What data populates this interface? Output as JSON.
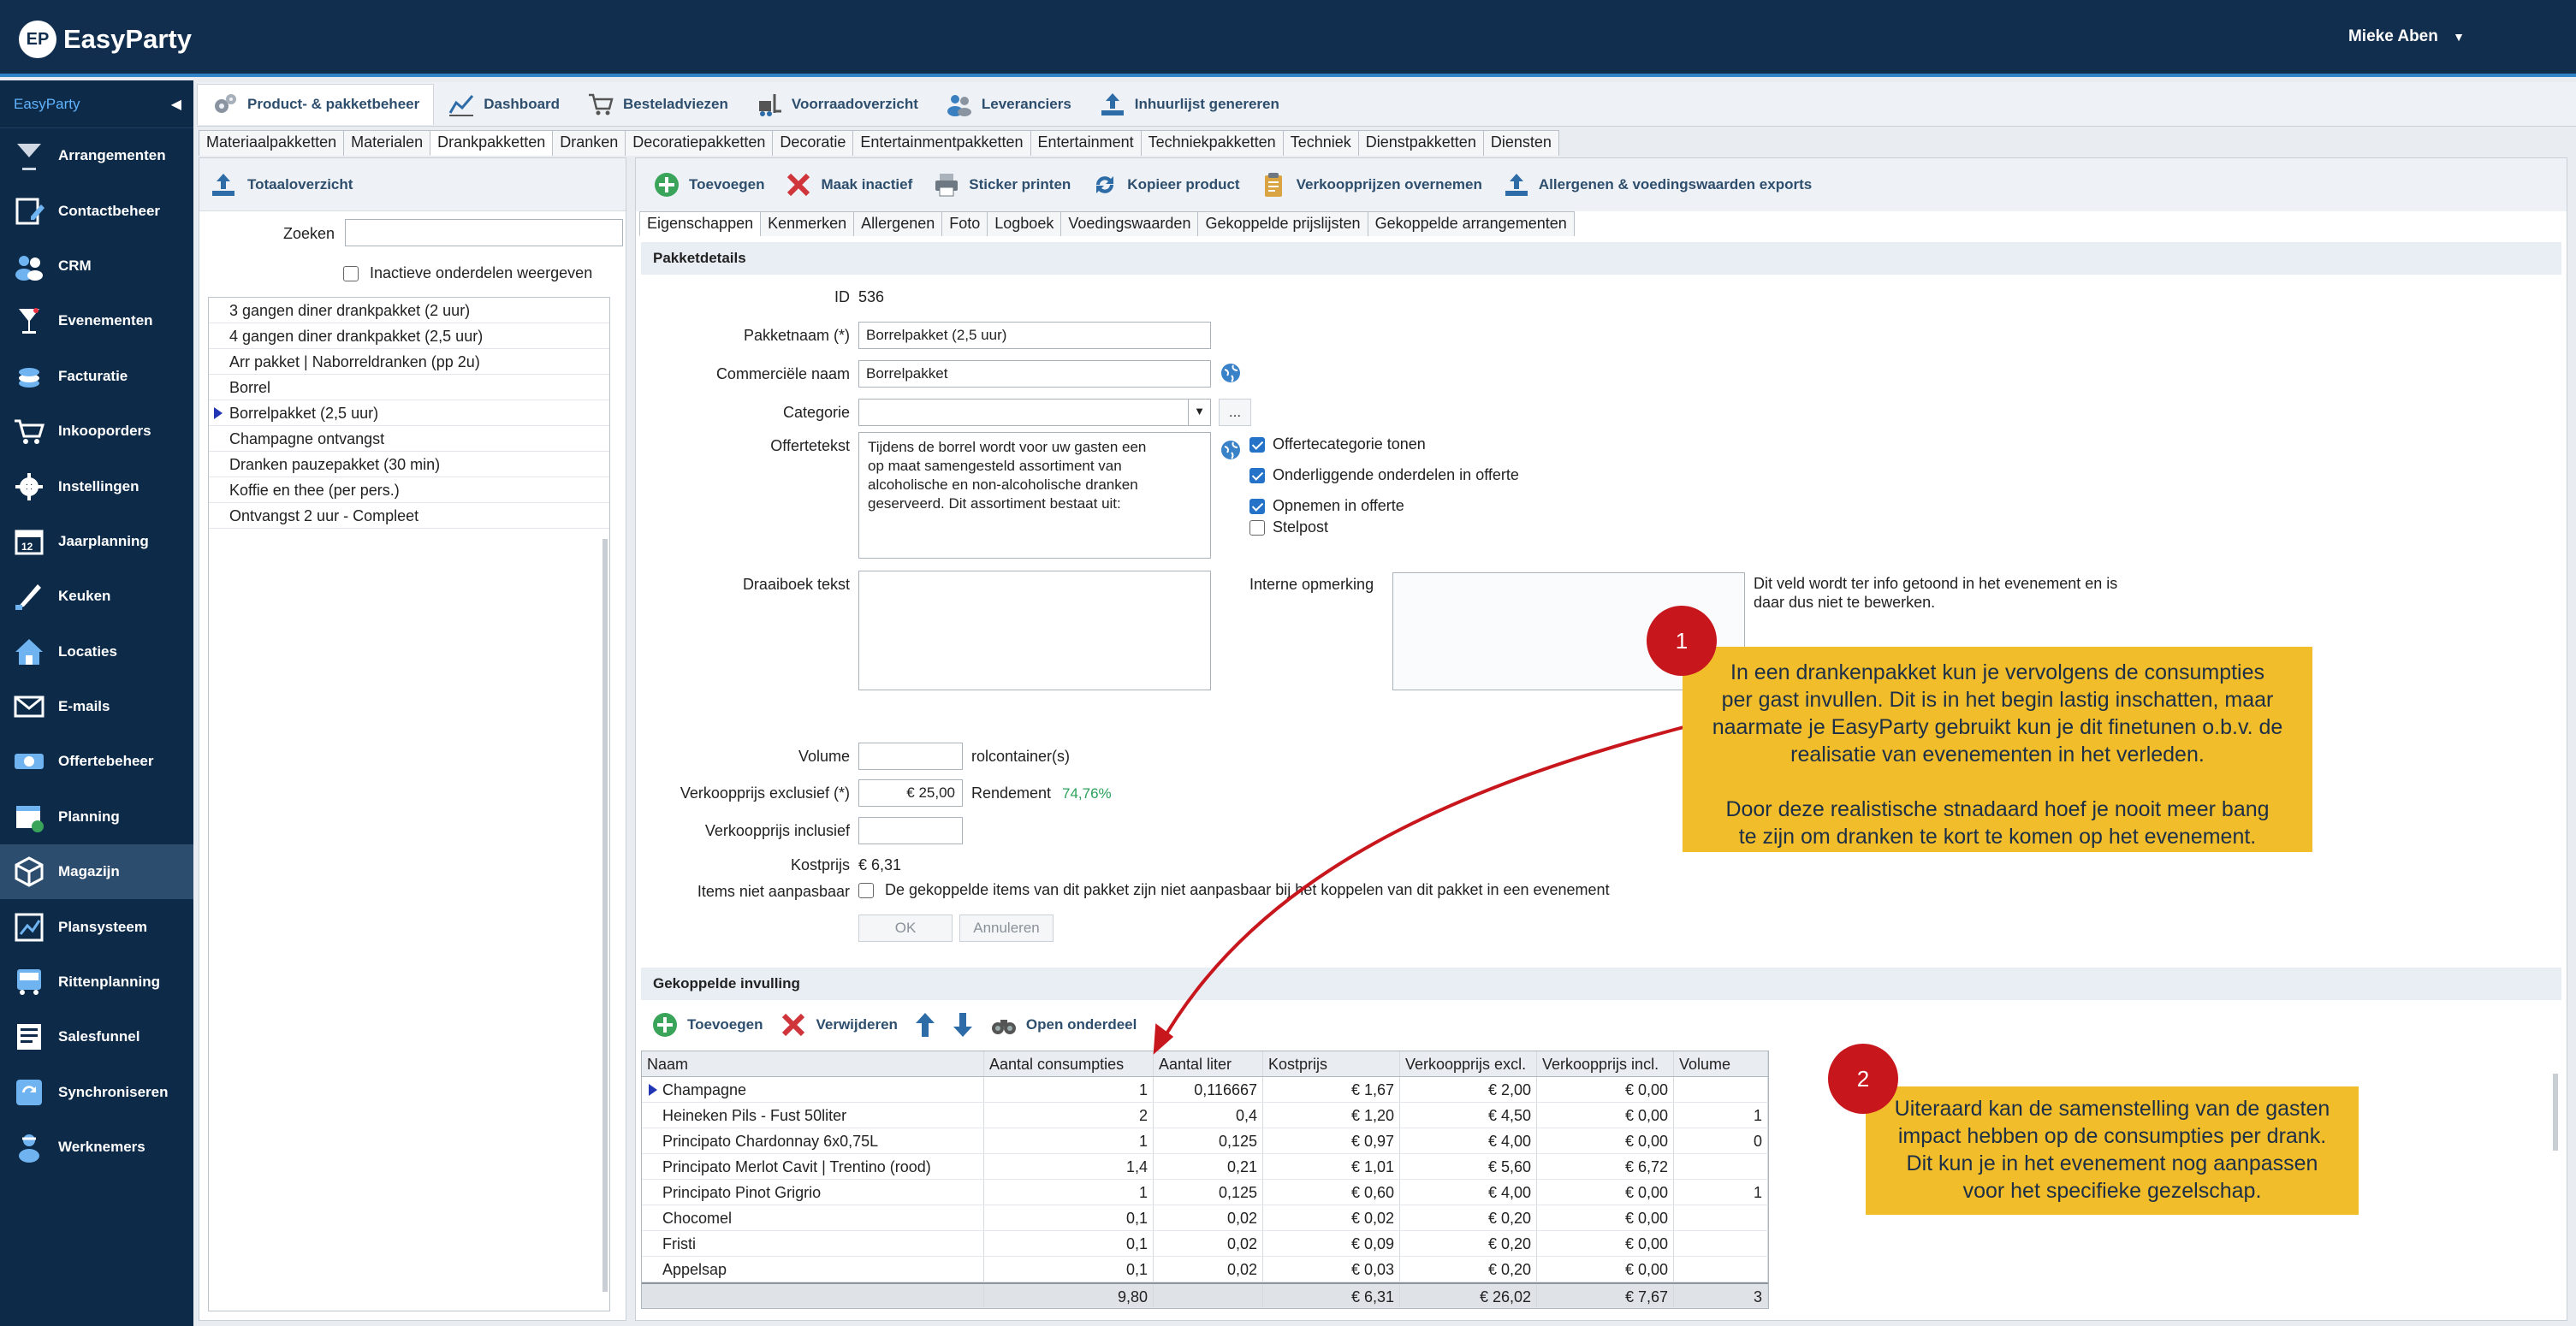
{
  "app": {
    "logo_badge": "EP",
    "name": "EasyParty",
    "user": "Mieke Aben"
  },
  "colors": {
    "nav_bg": "#0d2b49",
    "topbar": "#122e4e",
    "accent": "#2f83c8",
    "note": "#f1bd2a",
    "badge": "#c8161d",
    "margin_green": "#2aa15a"
  },
  "sidebar": {
    "header": "EasyParty",
    "items": [
      {
        "label": "Arrangementen",
        "icon": "cocktail-icon"
      },
      {
        "label": "Contactbeheer",
        "icon": "edit-contact-icon"
      },
      {
        "label": "CRM",
        "icon": "people-icon"
      },
      {
        "label": "Evenementen",
        "icon": "glass-icon"
      },
      {
        "label": "Facturatie",
        "icon": "coins-icon"
      },
      {
        "label": "Inkooporders",
        "icon": "cart-icon"
      },
      {
        "label": "Instellingen",
        "icon": "gear-icon"
      },
      {
        "label": "Jaarplanning",
        "icon": "calendar-icon"
      },
      {
        "label": "Keuken",
        "icon": "knife-icon"
      },
      {
        "label": "Locaties",
        "icon": "house-icon"
      },
      {
        "label": "E-mails",
        "icon": "mail-icon"
      },
      {
        "label": "Offertebeheer",
        "icon": "money-icon"
      },
      {
        "label": "Planning",
        "icon": "planning-icon"
      },
      {
        "label": "Magazijn",
        "icon": "box-icon"
      },
      {
        "label": "Plansysteem",
        "icon": "plan-icon"
      },
      {
        "label": "Rittenplanning",
        "icon": "bus-icon"
      },
      {
        "label": "Salesfunnel",
        "icon": "funnel-icon"
      },
      {
        "label": "Synchroniseren",
        "icon": "sync-icon"
      },
      {
        "label": "Werknemers",
        "icon": "worker-icon"
      }
    ]
  },
  "toolbar": {
    "items": [
      "Product- & pakketbeheer",
      "Dashboard",
      "Besteladviezen",
      "Voorraadoverzicht",
      "Leveranciers",
      "Inhuurlijst genereren"
    ]
  },
  "tabs": [
    "Materiaalpakketten",
    "Materialen",
    "Drankpakketten",
    "Dranken",
    "Decoratiepakketten",
    "Decoratie",
    "Entertainmentpakketten",
    "Entertainment",
    "Techniekpakketten",
    "Techniek",
    "Dienstpakketten",
    "Diensten"
  ],
  "left": {
    "toolbar_label": "Totaaloverzicht",
    "search_label": "Zoeken",
    "search_value": "",
    "inactive_label": "Inactieve onderdelen weergeven",
    "items": [
      "3 gangen diner drankpakket (2 uur)",
      "4 gangen diner drankpakket (2,5 uur)",
      "Arr pakket | Naborreldranken (pp 2u)",
      "Borrel",
      "Borrelpakket (2,5 uur)",
      "Champagne ontvangst",
      "Dranken pauzepakket (30 min)",
      "Koffie en thee (per pers.)",
      "Ontvangst 2 uur - Compleet"
    ]
  },
  "right_toolbar": [
    "Toevoegen",
    "Maak inactief",
    "Sticker printen",
    "Kopieer product",
    "Verkoopprijzen overnemen",
    "Allergenen & voedingswaarden exports"
  ],
  "subtabs": [
    "Eigenschappen",
    "Kenmerken",
    "Allergenen",
    "Foto",
    "Logboek",
    "Voedingswaarden",
    "Gekoppelde prijslijsten",
    "Gekoppelde arrangementen"
  ],
  "details": {
    "section": "Pakketdetails",
    "id_label": "ID",
    "id_value": "536",
    "name_label": "Pakketnaam (*)",
    "name_value": "Borrelpakket (2,5 uur)",
    "comm_label": "Commerciële naam",
    "comm_value": "Borrelpakket",
    "cat_label": "Categorie",
    "cat_value": "",
    "cat_more": "...",
    "offer_label": "Offertetekst",
    "offer_text": "Tijdens de borrel wordt voor uw gasten een\nop maat samengesteld assortiment van\nalcoholische en non-alcoholische dranken\ngeserveerd. Dit assortiment bestaat uit:",
    "chk_offertecategorie": "Offertecategorie tonen",
    "chk_onderliggende": "Onderliggende onderdelen in offerte",
    "chk_opnemen": "Opnemen in offerte",
    "chk_stelpost": "Stelpost",
    "draaiboek_label": "Draaiboek tekst",
    "intern_label": "Interne opmerking",
    "intern_info": "Dit veld wordt ter info getoond in het evenement en is\ndaar dus niet te bewerken.",
    "volume_label": "Volume",
    "volume_unit": "rolcontainer(s)",
    "price_ex_label": "Verkoopprijs exclusief (*)",
    "price_ex_value": "€ 25,00",
    "rendement_label": "Rendement",
    "rendement_value": "74,76%",
    "price_inc_label": "Verkoopprijs inclusief",
    "cost_label": "Kostprijs",
    "cost_value": "€ 6,31",
    "fixed_label": "Items niet aanpasbaar",
    "fixed_text": "De gekoppelde items van dit pakket zijn niet aanpasbaar bij het koppelen van dit pakket in een evenement",
    "ok": "OK",
    "cancel": "Annuleren"
  },
  "linked": {
    "section": "Gekoppelde invulling",
    "toolbar": {
      "add": "Toevoegen",
      "remove": "Verwijderen",
      "open": "Open onderdeel"
    },
    "headers": [
      "Naam",
      "Aantal consumpties",
      "Aantal liter",
      "Kostprijs",
      "Verkoopprijs excl.",
      "Verkoopprijs incl.",
      "Volume"
    ],
    "rows": [
      [
        "Champagne",
        "1",
        "0,116667",
        "€ 1,67",
        "€ 2,00",
        "€ 0,00",
        ""
      ],
      [
        "Heineken Pils - Fust 50liter",
        "2",
        "0,4",
        "€ 1,20",
        "€ 4,50",
        "€ 0,00",
        "1"
      ],
      [
        "Principato Chardonnay 6x0,75L",
        "1",
        "0,125",
        "€ 0,97",
        "€ 4,00",
        "€ 0,00",
        "0"
      ],
      [
        "Principato Merlot Cavit | Trentino (rood)",
        "1,4",
        "0,21",
        "€ 1,01",
        "€ 5,60",
        "€ 6,72",
        ""
      ],
      [
        "Principato Pinot Grigrio",
        "1",
        "0,125",
        "€ 0,60",
        "€ 4,00",
        "€ 0,00",
        "1"
      ],
      [
        "Chocomel",
        "0,1",
        "0,02",
        "€ 0,02",
        "€ 0,20",
        "€ 0,00",
        ""
      ],
      [
        "Fristi",
        "0,1",
        "0,02",
        "€ 0,09",
        "€ 0,20",
        "€ 0,00",
        ""
      ],
      [
        "Appelsap",
        "0,1",
        "0,02",
        "€ 0,03",
        "€ 0,20",
        "€ 0,00",
        ""
      ]
    ],
    "totals": [
      "",
      "9,80",
      "",
      "€ 6,31",
      "€ 26,02",
      "€ 7,67",
      "3"
    ]
  },
  "notes": {
    "badge1": "1",
    "note1": "In een drankenpakket kun je vervolgens de consumpties\nper gast invullen. Dit is in het begin lastig inschatten, maar\nnaarmate je EasyParty gebruikt kun je dit finetunen o.b.v. de\nrealisatie van evenementen in het verleden.\n\nDoor deze realistische stnadaard hoef je nooit meer bang\nte zijn om dranken te kort te komen op het evenement.",
    "badge2": "2",
    "note2": "Uiteraard kan de samenstelling van de gasten\nimpact hebben op de consumpties per drank.\nDit kun je in het evenement nog aanpassen\nvoor het specifieke gezelschap."
  }
}
